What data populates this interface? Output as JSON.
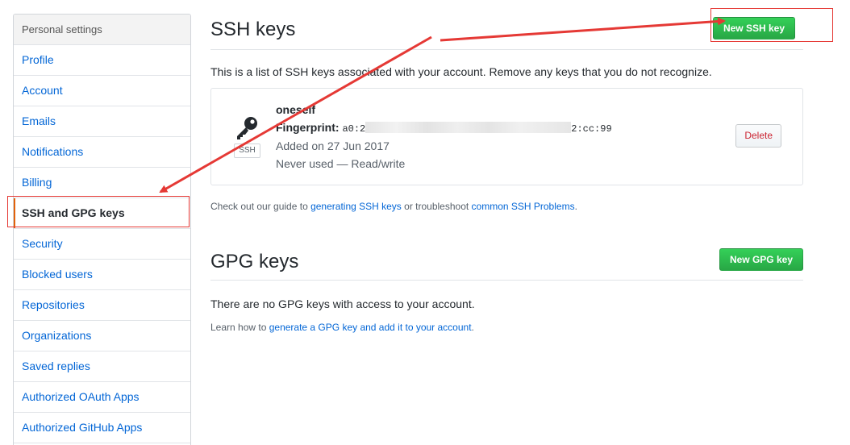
{
  "sidebar": {
    "header": "Personal settings",
    "items": [
      {
        "label": "Profile"
      },
      {
        "label": "Account"
      },
      {
        "label": "Emails"
      },
      {
        "label": "Notifications"
      },
      {
        "label": "Billing"
      },
      {
        "label": "SSH and GPG keys",
        "selected": true
      },
      {
        "label": "Security"
      },
      {
        "label": "Blocked users"
      },
      {
        "label": "Repositories"
      },
      {
        "label": "Organizations"
      },
      {
        "label": "Saved replies"
      },
      {
        "label": "Authorized OAuth Apps"
      },
      {
        "label": "Authorized GitHub Apps"
      }
    ]
  },
  "ssh": {
    "title": "SSH keys",
    "new_button": "New SSH key",
    "description": "This is a list of SSH keys associated with your account. Remove any keys that you do not recognize.",
    "key": {
      "title": "oneself",
      "fingerprint_label": "Fingerprint:",
      "fingerprint_start": "a0:2",
      "fingerprint_end": "2:cc:99",
      "added": "Added on 27 Jun 2017",
      "usage": "Never used — Read/write",
      "type_label": "SSH",
      "delete_button": "Delete"
    },
    "guide": {
      "prefix": "Check out our guide to ",
      "link1": "generating SSH keys",
      "middle": " or troubleshoot ",
      "link2": "common SSH Problems",
      "suffix": "."
    }
  },
  "gpg": {
    "title": "GPG keys",
    "new_button": "New GPG key",
    "empty": "There are no GPG keys with access to your account.",
    "learn": {
      "prefix": "Learn how to ",
      "link": "generate a GPG key and add it to your account",
      "suffix": "."
    }
  },
  "colors": {
    "link": "#0366d6",
    "green": "#28a745",
    "annotation": "#e53935",
    "selected_bar": "#e36209"
  }
}
